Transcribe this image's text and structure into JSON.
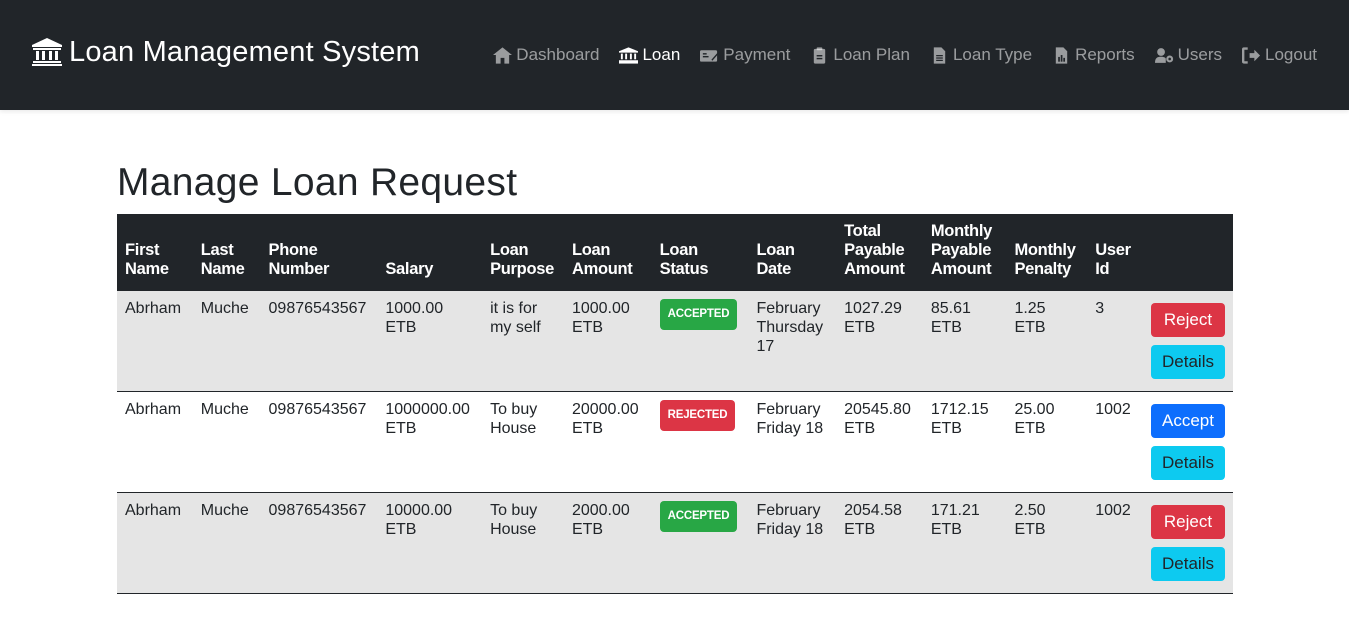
{
  "brand": {
    "title": "Loan Management System",
    "icon": "bank-icon"
  },
  "nav": [
    {
      "label": "Dashboard",
      "icon": "home-icon",
      "active": false
    },
    {
      "label": "Loan",
      "icon": "bank-icon",
      "active": true
    },
    {
      "label": "Payment",
      "icon": "money-check-icon",
      "active": false
    },
    {
      "label": "Loan Plan",
      "icon": "clipboard-check-icon",
      "active": false
    },
    {
      "label": "Loan Type",
      "icon": "file-alt-icon",
      "active": false
    },
    {
      "label": "Reports",
      "icon": "file-chart-icon",
      "active": false
    },
    {
      "label": "Users",
      "icon": "user-cog-icon",
      "active": false
    },
    {
      "label": "Logout",
      "icon": "sign-out-icon",
      "active": false
    }
  ],
  "page": {
    "title": "Manage Loan Request"
  },
  "table": {
    "headers": {
      "first_name": "First Name",
      "last_name": "Last Name",
      "phone": "Phone Number",
      "salary": "Salary",
      "purpose": "Loan Purpose",
      "amount": "Loan Amount",
      "status": "Loan Status",
      "date": "Loan Date",
      "total": "Total Payable Amount",
      "monthly": "Monthly Payable Amount",
      "penalty": "Monthly Penalty",
      "user_id": "User Id"
    },
    "rows": [
      {
        "first_name": "Abrham",
        "last_name": "Muche",
        "phone": "09876543567",
        "salary": "1000.00 ETB",
        "purpose": "it is for my self",
        "amount": "1000.00 ETB",
        "status": "ACCEPTED",
        "date": "February Thursday 17",
        "total": "1027.29 ETB",
        "monthly": "85.61 ETB",
        "penalty": "1.25 ETB",
        "user_id": "3",
        "primary_action": "Reject",
        "details_action": "Details"
      },
      {
        "first_name": "Abrham",
        "last_name": "Muche",
        "phone": "09876543567",
        "salary": "1000000.00 ETB",
        "purpose": "To buy House",
        "amount": "20000.00 ETB",
        "status": "REJECTED",
        "date": "February Friday 18",
        "total": "20545.80 ETB",
        "monthly": "1712.15 ETB",
        "penalty": "25.00 ETB",
        "user_id": "1002",
        "primary_action": "Accept",
        "details_action": "Details"
      },
      {
        "first_name": "Abrham",
        "last_name": "Muche",
        "phone": "09876543567",
        "salary": "10000.00 ETB",
        "purpose": "To buy House",
        "amount": "2000.00 ETB",
        "status": "ACCEPTED",
        "date": "February Friday 18",
        "total": "2054.58 ETB",
        "monthly": "171.21 ETB",
        "penalty": "2.50 ETB",
        "user_id": "1002",
        "primary_action": "Reject",
        "details_action": "Details"
      }
    ]
  },
  "colors": {
    "navbar": "#212529",
    "accepted": "#28a745",
    "rejected": "#dc3545",
    "accept_button": "#0d6efd",
    "details_button": "#0dcaf0",
    "row_stripe": "#e5e5e5"
  }
}
